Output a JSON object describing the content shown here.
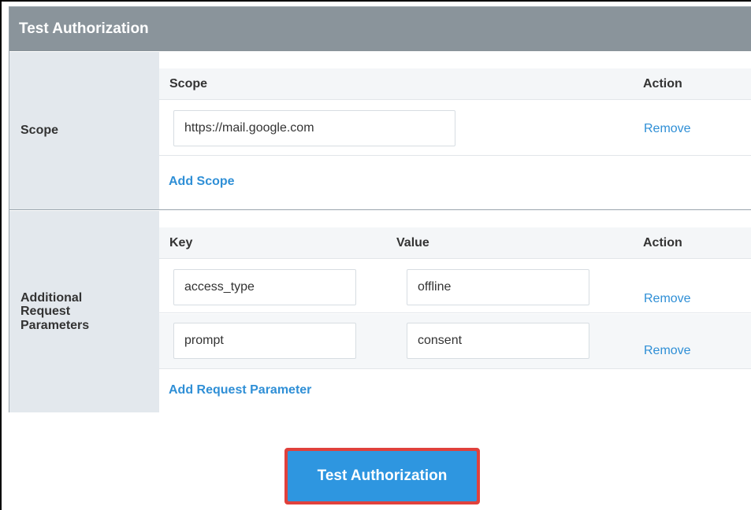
{
  "panel": {
    "title": "Test Authorization"
  },
  "scope_section": {
    "label": "Scope",
    "columns": {
      "scope": "Scope",
      "action": "Action"
    },
    "rows": [
      {
        "value": "https://mail.google.com",
        "action": "Remove"
      }
    ],
    "add_link": "Add Scope"
  },
  "params_section": {
    "label": "Additional Request Parameters",
    "columns": {
      "key": "Key",
      "value": "Value",
      "action": "Action"
    },
    "rows": [
      {
        "key": "access_type",
        "value": "offline",
        "action": "Remove"
      },
      {
        "key": "prompt",
        "value": "consent",
        "action": "Remove"
      }
    ],
    "add_link": "Add Request Parameter"
  },
  "footer": {
    "test_button": "Test Authorization"
  },
  "colors": {
    "header_bg": "#8a949b",
    "label_bg": "#e3e8ed",
    "link": "#2f8fd6",
    "button_bg": "#2e96e0",
    "highlight_border": "#e0413c"
  }
}
